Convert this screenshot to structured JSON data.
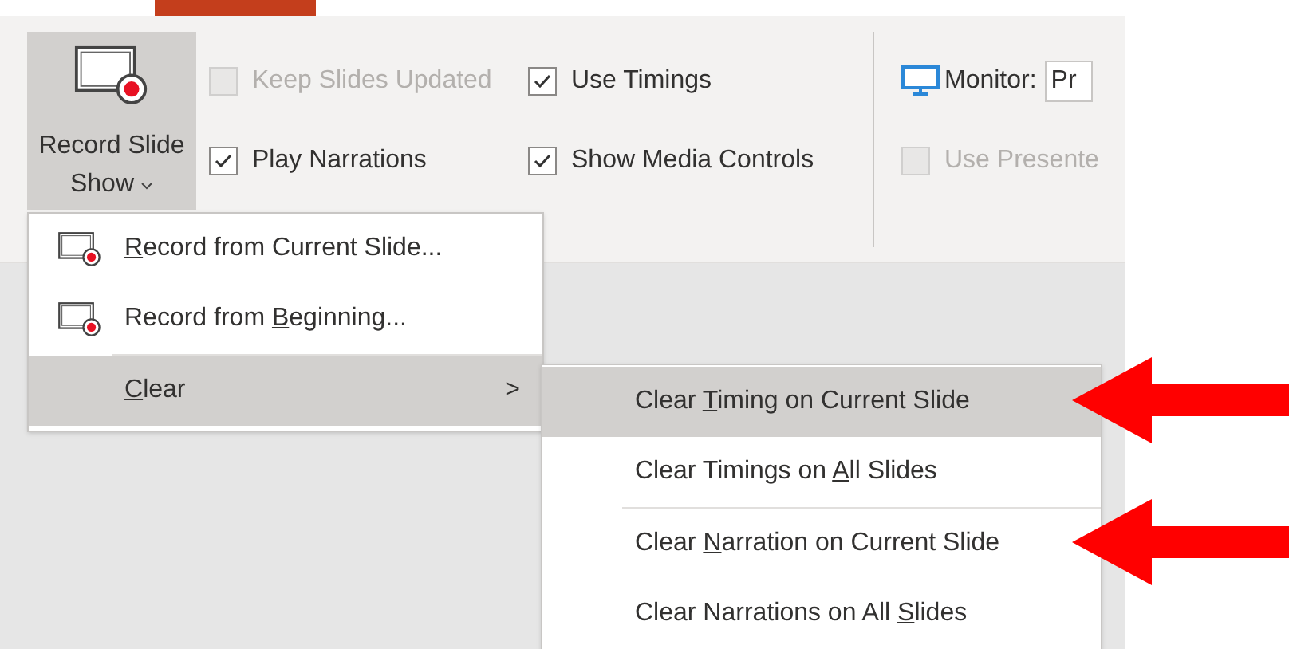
{
  "ribbon": {
    "record_button": {
      "label_line_1": "Record Slide",
      "label_line_2": "Show",
      "expanded": true
    },
    "checkboxes": [
      {
        "label": "Keep Slides Updated",
        "checked": false,
        "disabled": true
      },
      {
        "label": "Play Narrations",
        "checked": true,
        "disabled": false
      },
      {
        "label": "Use Timings",
        "checked": true,
        "disabled": false
      },
      {
        "label": "Show Media Controls",
        "checked": true,
        "disabled": false
      }
    ],
    "monitor": {
      "label": "Monitor:",
      "value": "Pr"
    },
    "presenter_checkbox": {
      "label": "Use Presente",
      "checked": false,
      "disabled": true
    }
  },
  "menu": {
    "items": [
      {
        "kind": "command",
        "label_parts": {
          "key": "R",
          "after": "ecord from Current Slide..."
        },
        "selected": false
      },
      {
        "kind": "command",
        "label_parts": {
          "before": "Record from ",
          "key": "B",
          "after": "eginning..."
        },
        "selected": false
      },
      {
        "kind": "submenu",
        "label_parts": {
          "key": "C",
          "after": "lear"
        },
        "selected": true,
        "arrow": ">"
      }
    ]
  },
  "submenu": {
    "items": [
      {
        "label_parts": {
          "before": "Clear ",
          "key": "T",
          "after": "iming on Current Slide"
        },
        "selected": true,
        "annotated": true
      },
      {
        "label_parts": {
          "before": "Clear Timings on ",
          "key": "A",
          "after": "ll Slides"
        },
        "selected": false,
        "annotated": false
      },
      {
        "label_parts": {
          "before": "Clear ",
          "key": "N",
          "after": "arration on Current Slide"
        },
        "selected": false,
        "annotated": true
      },
      {
        "label_parts": {
          "before": "Clear Narrations on All ",
          "key": "S",
          "after": "lides"
        },
        "selected": false,
        "annotated": false
      }
    ]
  }
}
